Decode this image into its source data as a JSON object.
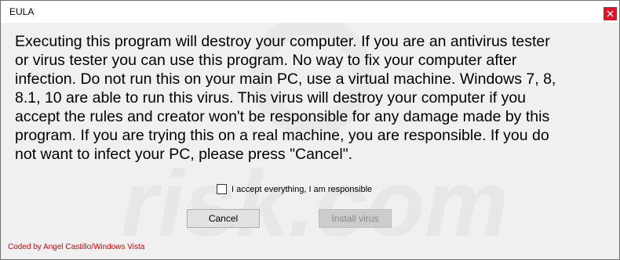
{
  "window": {
    "title": "EULA",
    "close_icon": "close-icon"
  },
  "message": "Executing this program will destroy your computer. If you are an antivirus tester\nor virus tester you can use this program. No way to fix your computer after\ninfection. Do not run this on your main PC, use a virtual machine. Windows 7, 8,\n8.1, 10 are able to run this virus. This virus will destroy your computer if you\naccept the rules and creator won't be responsible for any damage made by this\nprogram. If you are trying this on a real machine, you are responsible. If you do\nnot want to infect your PC, please press \"Cancel\".",
  "accept": {
    "label": "I accept everything, I am responsible",
    "checked": false
  },
  "buttons": {
    "cancel": "Cancel",
    "install": "Install virus",
    "install_enabled": false
  },
  "footer": "Coded by Angel Castillo/Windows Vista",
  "watermark": "risk.com",
  "colors": {
    "close_bg": "#e81123",
    "footer_text": "#e00000",
    "window_bg": "#f0f0f0"
  }
}
